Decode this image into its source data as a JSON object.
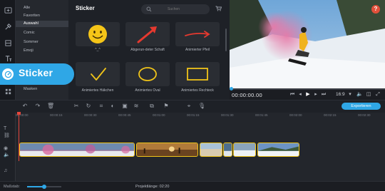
{
  "rail": {
    "icons": [
      "import-icon",
      "tools-icon",
      "filters-icon",
      "titles-icon",
      "stickers-icon",
      "more-icon"
    ]
  },
  "categories": {
    "items": [
      {
        "label": "Alle"
      },
      {
        "label": "Favoriten"
      },
      {
        "label": "Auswahl",
        "active": true
      },
      {
        "label": "Comic"
      },
      {
        "label": "Sommer"
      },
      {
        "label": "Emoji"
      },
      {
        "label": "..."
      },
      {
        "label": "..."
      },
      {
        "label": "Masken"
      }
    ]
  },
  "callout": {
    "label": "Sticker"
  },
  "panel": {
    "title": "Sticker",
    "search_placeholder": "Suchen",
    "stickers": [
      {
        "label": "^_^",
        "icon": "smiley-icon"
      },
      {
        "label": "Abgerun-deter Schaft",
        "icon": "arrow-icon"
      },
      {
        "label": "Animierter Pfeil",
        "icon": "curved-arrow-icon"
      },
      {
        "label": "Animiertes Häkchen",
        "icon": "checkmark-icon"
      },
      {
        "label": "Animiertes Oval",
        "icon": "oval-icon"
      },
      {
        "label": "Animiertes Rechteck",
        "icon": "rectangle-icon"
      }
    ]
  },
  "player": {
    "timecode": "00:00:00.00",
    "aspect": "16:9",
    "progress": 0.0
  },
  "toolbar": {
    "export_label": "Exportieren"
  },
  "timeline": {
    "ruler": [
      "00:00:00",
      "00:00:15",
      "00:00:30",
      "00:00:45",
      "00:01:00",
      "00:01:15",
      "00:01:30",
      "00:01:45",
      "00:02:00",
      "00:02:15",
      "00:02:30",
      "00:02:45",
      "00:03:00"
    ],
    "clips": [
      {
        "name": "ski-clip-1",
        "color": "#9a6a9e"
      },
      {
        "name": "sunset-clip",
        "color": "#7a4d24"
      },
      {
        "name": "snow-clip-1",
        "color": "#c9b99a"
      },
      {
        "name": "snow-clip-2",
        "color": "#5a7ea0"
      },
      {
        "name": "snow-clip-3",
        "color": "#8aa4bc"
      },
      {
        "name": "snow-clip-4",
        "color": "#6c94c4"
      }
    ]
  },
  "bottom": {
    "scale_label": "Maßstab:",
    "duration": "Projektlänge: 02:20",
    "zoom": 0.5
  },
  "colors": {
    "accent": "#2fa7e6",
    "playhead": "#e6463c",
    "clip_border": "#f0c419"
  }
}
